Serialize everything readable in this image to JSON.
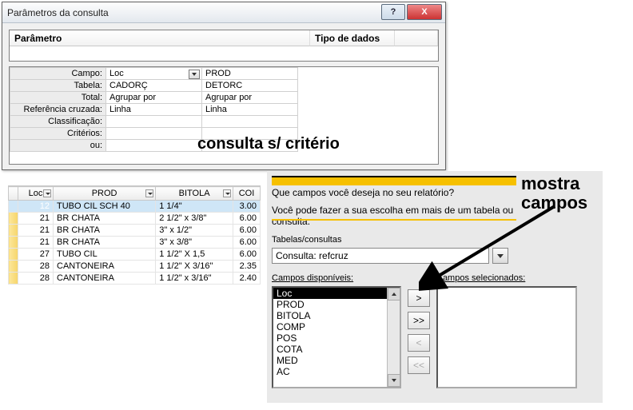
{
  "window": {
    "title": "Parâmetros da consulta",
    "col_param": "Parâmetro",
    "col_type": "Tipo de dados"
  },
  "design_rows": {
    "labels": [
      "Campo:",
      "Tabela:",
      "Total:",
      "Referência cruzada:",
      "Classificação:",
      "Critérios:",
      "ou:"
    ],
    "col1": [
      "Loc",
      "CADORÇ",
      "Agrupar por",
      "Linha",
      "",
      "",
      ""
    ],
    "col2": [
      "PROD",
      "DETORC",
      "Agrupar por",
      "Linha",
      "",
      "",
      ""
    ]
  },
  "annotation1": "consulta s/ critério",
  "datasheet": {
    "headers": [
      "Loc",
      "PROD",
      "BITOLA",
      "COI"
    ],
    "rows": [
      {
        "loc": "12",
        "prod": "TUBO CIL SCH 40",
        "bitola": "1 1/4\"",
        "coi": "3.00",
        "selected": true
      },
      {
        "loc": "21",
        "prod": "BR CHATA",
        "bitola": "2 1/2\" x 3/8\"",
        "coi": "6.00"
      },
      {
        "loc": "21",
        "prod": "BR CHATA",
        "bitola": "3\" x 1/2\"",
        "coi": "6.00"
      },
      {
        "loc": "21",
        "prod": "BR CHATA",
        "bitola": "3\" x 3/8\"",
        "coi": "6.00"
      },
      {
        "loc": "27",
        "prod": "TUBO CIL",
        "bitola": "1 1/2\" X 1,5",
        "coi": "6.00"
      },
      {
        "loc": "28",
        "prod": "CANTONEIRA",
        "bitola": "1 1/2\" X 3/16\"",
        "coi": "2.35"
      },
      {
        "loc": "28",
        "prod": "CANTONEIRA",
        "bitola": "1 1/2\" x 3/16\"",
        "coi": "2.40"
      }
    ]
  },
  "wizard": {
    "q1": "Que campos você deseja no seu relatório?",
    "q2": "Você pode fazer a sua escolha em mais de um tabela ou consulta.",
    "tables_label": "Tabelas/consultas",
    "combo_value": "Consulta: refcruz",
    "avail_label": "Campos disponíveis:",
    "sel_label": "Campos selecionados:",
    "available": [
      "Loc",
      "PROD",
      "BITOLA",
      "COMP",
      "POS",
      "COTA",
      "MED",
      "AC"
    ],
    "buttons": {
      "add": ">",
      "add_all": ">>",
      "remove": "<",
      "remove_all": "<<"
    }
  },
  "annotation2_l1": "mostra",
  "annotation2_l2": "campos"
}
